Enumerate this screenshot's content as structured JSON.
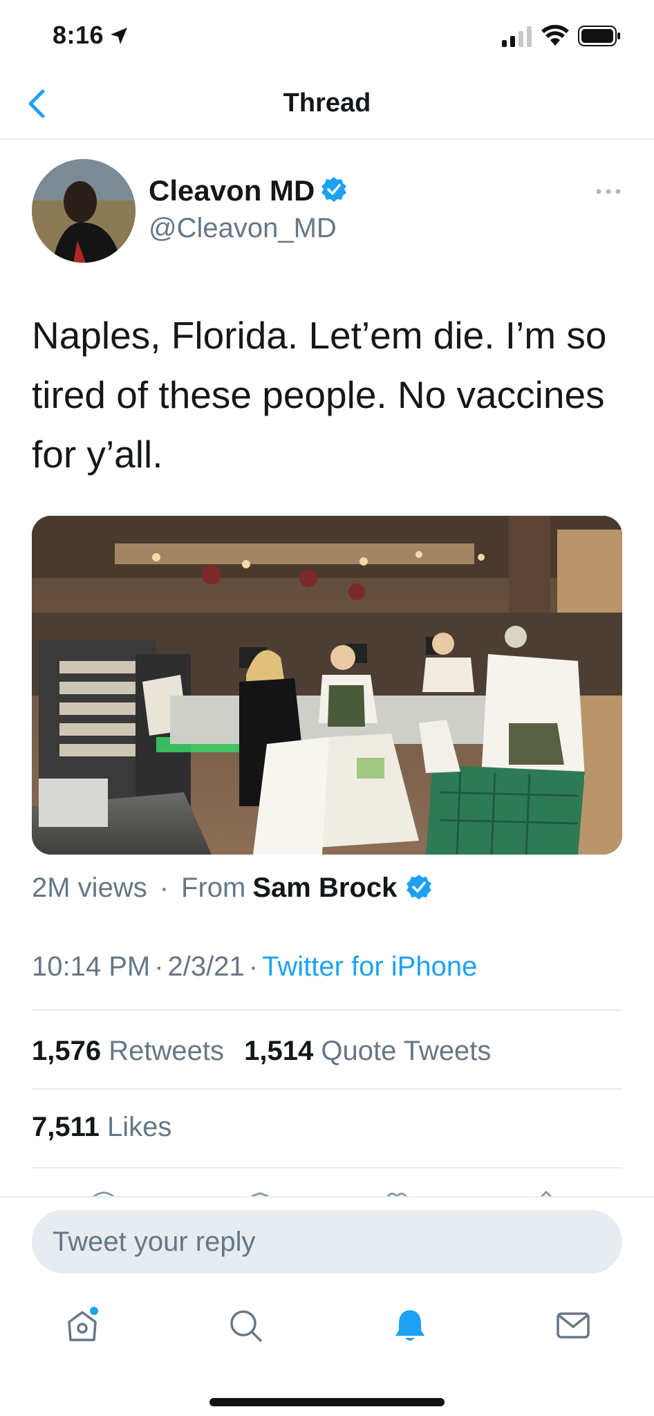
{
  "status_bar": {
    "time": "8:16"
  },
  "nav": {
    "title": "Thread"
  },
  "tweet": {
    "author_name": "Cleavon MD",
    "author_handle": "@Cleavon_MD",
    "text": "Naples, Florida. Let’em die. I’m so tired of these people. No vaccines for y’all.",
    "views": "2M views",
    "from_label": "From",
    "from_name": "Sam Brock",
    "time": "10:14 PM",
    "date": "2/3/21",
    "source": "Twitter for iPhone",
    "retweets_count": "1,576",
    "retweets_label": "Retweets",
    "quotes_count": "1,514",
    "quotes_label": "Quote Tweets",
    "likes_count": "7,511",
    "likes_label": "Likes"
  },
  "reply": {
    "placeholder": "Tweet your reply"
  },
  "tabs": [
    {
      "icon": "home-icon"
    },
    {
      "icon": "search-icon"
    },
    {
      "icon": "notifications-bell-icon"
    },
    {
      "icon": "messages-envelope-icon"
    }
  ],
  "colors": {
    "accent": "#1da1f2",
    "secondary_text": "#657786",
    "primary_text": "#14171a",
    "divider": "#e6ecf0"
  }
}
